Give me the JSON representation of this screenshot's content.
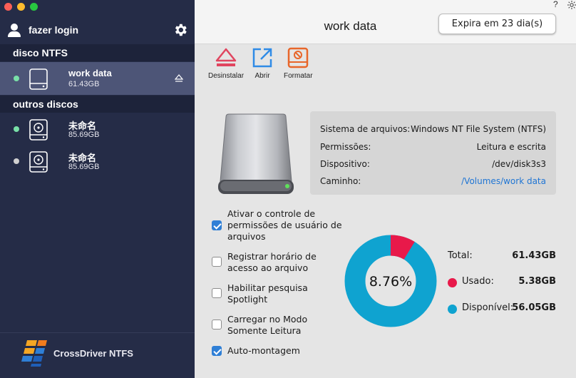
{
  "sidebar": {
    "login_label": "fazer login",
    "section_ntfs": "disco NTFS",
    "section_other": "outros discos",
    "ntfs_disks": [
      {
        "name": "work data",
        "size": "61.43GB",
        "status": "green"
      }
    ],
    "other_disks": [
      {
        "name": "未命名",
        "size": "85.69GB",
        "status": "green"
      },
      {
        "name": "未命名",
        "size": "85.69GB",
        "status": "grey"
      }
    ],
    "brand": "CrossDriver NTFS"
  },
  "header": {
    "title": "work data",
    "help": "?",
    "expiry_button": "Expira em 23 dia(s)"
  },
  "toolbar": {
    "uninstall_label": "Desinstalar",
    "open_label": "Abrir",
    "format_label": "Formatar"
  },
  "info": {
    "filesystem_label": "Sistema de arquivos:",
    "filesystem_value": "Windows NT File System (NTFS)",
    "permissions_label": "Permissões:",
    "permissions_value": "Leitura e escrita",
    "device_label": "Dispositivo:",
    "device_value": "/dev/disk3s3",
    "path_label": "Caminho:",
    "path_value": "/Volumes/work data"
  },
  "options": [
    {
      "label_l1": "Ativar o controle de",
      "label_l2": "permissões de usuário de",
      "label_l3": "arquivos",
      "checked": true
    },
    {
      "label_l1": "Registrar horário de",
      "label_l2": "acesso ao arquivo",
      "checked": false
    },
    {
      "label_l1": "Habilitar pesquisa",
      "label_l2": "Spotlight",
      "checked": false
    },
    {
      "label_l1": "Carregar no Modo",
      "label_l2": "Somente Leitura",
      "checked": false
    },
    {
      "label_l1": "Auto-montagem",
      "checked": true
    }
  ],
  "usage": {
    "percent_label": "8.76%",
    "used_fraction": 0.0876,
    "total_label": "Total:",
    "total_value": "61.43GB",
    "used_label": "Usado:",
    "used_value": "5.38GB",
    "free_label": "Disponível:",
    "free_value": "56.05GB",
    "used_color": "#e8194a",
    "free_color": "#0fa3d0"
  },
  "colors": {
    "sidebar_bg": "#252c47",
    "selected_bg": "#4d5577",
    "accent_blue": "#2f7fd6"
  }
}
